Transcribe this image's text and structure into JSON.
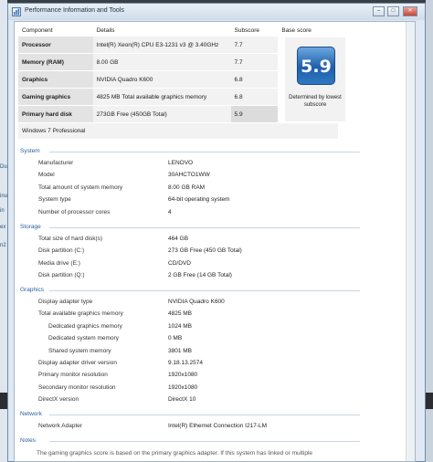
{
  "window": {
    "title": "Performance Information and Tools"
  },
  "background": {
    "left_fragments": [
      "Du",
      "inu",
      "in",
      "ex",
      "n2"
    ]
  },
  "score_table": {
    "headers": {
      "component": "Component",
      "details": "Details",
      "subscore": "Subscore",
      "base": "Base score"
    },
    "rows": [
      {
        "component": "Processor",
        "details": "Intel(R) Xeon(R) CPU E3-1231 v3 @ 3.40GHz",
        "subscore": "7.7"
      },
      {
        "component": "Memory (RAM)",
        "details": "8.00 GB",
        "subscore": "7.7"
      },
      {
        "component": "Graphics",
        "details": "NVIDIA Quadro K600",
        "subscore": "6.8"
      },
      {
        "component": "Gaming graphics",
        "details": "4825 MB Total available graphics memory",
        "subscore": "6.8"
      },
      {
        "component": "Primary hard disk",
        "details": "273GB Free (450GB Total)",
        "subscore": "5.9"
      }
    ],
    "base_score": "5.9",
    "base_note": "Determined by lowest subscore",
    "os": "Windows 7 Professional"
  },
  "system": {
    "title": "System",
    "rows": [
      {
        "label": "Manufacturer",
        "value": "LENOVO"
      },
      {
        "label": "Model",
        "value": "30AHCTO1WW"
      },
      {
        "label": "Total amount of system memory",
        "value": "8.00 GB RAM"
      },
      {
        "label": "System type",
        "value": "64-bit operating system"
      },
      {
        "label": "Number of processor cores",
        "value": "4"
      }
    ]
  },
  "storage": {
    "title": "Storage",
    "rows": [
      {
        "label": "Total size of hard disk(s)",
        "value": "464 GB"
      },
      {
        "label": "Disk partition (C:)",
        "value": "273 GB Free (450 GB Total)"
      },
      {
        "label": "Media drive (E:)",
        "value": "CD/DVD"
      },
      {
        "label": "Disk partition (Q:)",
        "value": "2 GB Free (14 GB Total)"
      }
    ]
  },
  "graphics": {
    "title": "Graphics",
    "rows": [
      {
        "label": "Display adapter type",
        "value": "NVIDIA Quadro K600"
      },
      {
        "label": "Total available graphics memory",
        "value": "4825 MB"
      },
      {
        "label": "Dedicated graphics memory",
        "value": "1024 MB"
      },
      {
        "label": "Dedicated system memory",
        "value": "0 MB"
      },
      {
        "label": "Shared system memory",
        "value": "3801 MB"
      },
      {
        "label": "Display adapter driver version",
        "value": "9.18.13.2574"
      },
      {
        "label": "Primary monitor resolution",
        "value": "1920x1080"
      },
      {
        "label": "Secondary monitor resolution",
        "value": "1920x1080"
      },
      {
        "label": "DirectX version",
        "value": "DirectX 10"
      }
    ]
  },
  "network": {
    "title": "Network",
    "rows": [
      {
        "label": "Network Adapter",
        "value": "Intel(R) Ethernet Connection I217-LM"
      }
    ]
  },
  "notes": {
    "title": "Notes",
    "text": "The gaming graphics score is based on the primary graphics adapter. If this system has linked or multiple"
  }
}
